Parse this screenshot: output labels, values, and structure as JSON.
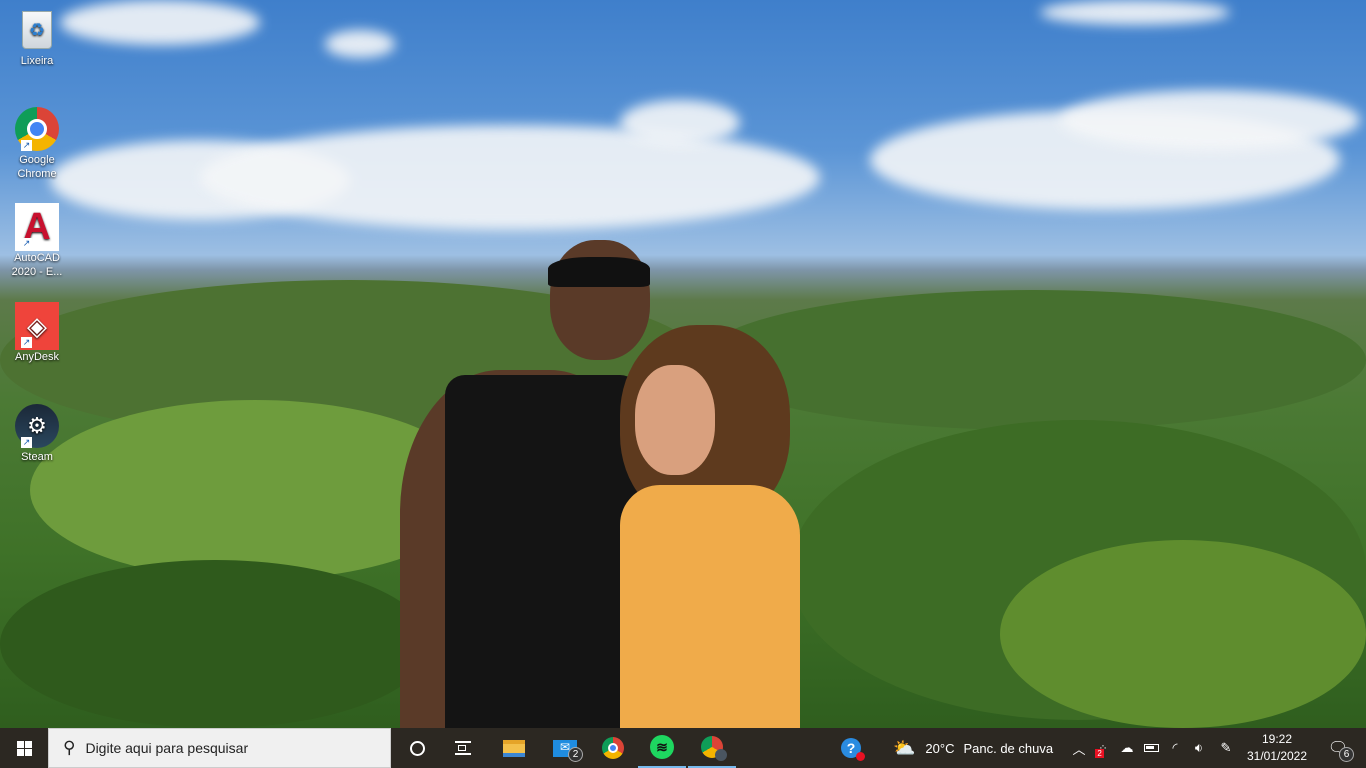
{
  "desktop": {
    "icons": [
      {
        "label": "Lixeira",
        "icon": "recycle-bin-icon"
      },
      {
        "label": "Google Chrome",
        "icon": "chrome-icon"
      },
      {
        "label": "AutoCAD 2020 - E...",
        "icon": "autocad-icon"
      },
      {
        "label": "AnyDesk",
        "icon": "anydesk-icon"
      },
      {
        "label": "Steam",
        "icon": "steam-icon"
      }
    ]
  },
  "taskbar": {
    "search_placeholder": "Digite aqui para pesquisar",
    "mail_badge": "2",
    "weather": {
      "temp": "20°C",
      "condition": "Panc. de chuva"
    },
    "tray": {
      "alert_badge": "2"
    },
    "clock": {
      "time": "19:22",
      "date": "31/01/2022"
    },
    "notifications_badge": "6"
  },
  "colors": {
    "taskbar": "#2c2822",
    "accent": "#76b9ed"
  }
}
